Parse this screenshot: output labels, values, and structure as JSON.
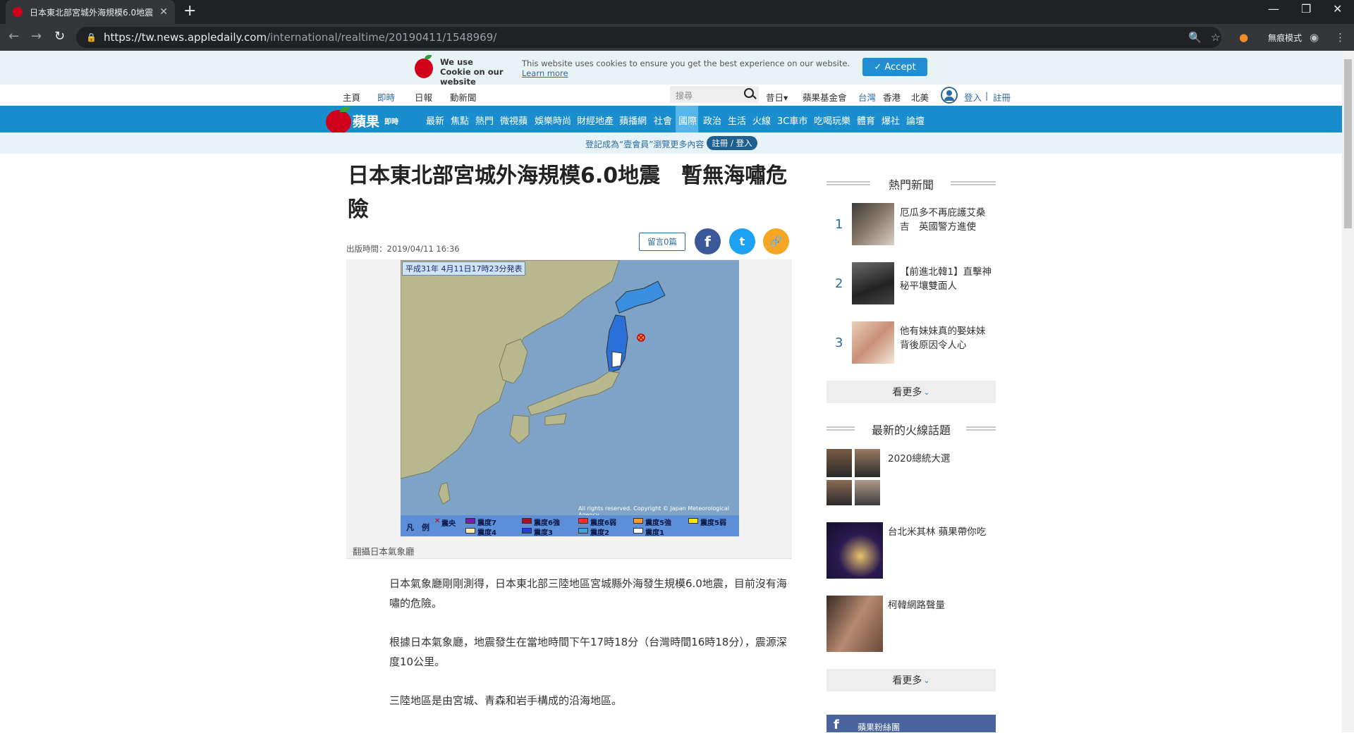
{
  "browser": {
    "tab_title": "日本東北部宮城外海規模6.0地震",
    "new_tab": "+",
    "url_host": "https://tw.news.appledaily.com",
    "url_path": "/international/realtime/20190411/1548969/",
    "incognito_label": "無痕模式",
    "window_controls": [
      "—",
      "❐",
      "✕"
    ]
  },
  "cookie_bar": {
    "title": "We use Cookie on our website",
    "message": "This website uses cookies to ensure you get the best experience on our website.",
    "learn_more": "Learn more",
    "accept": "✓ Accept"
  },
  "top_links": {
    "left": [
      "主頁",
      "即時",
      "日報",
      "動新聞"
    ],
    "search_placeholder": "搜尋",
    "past": "昔日▾",
    "fund": "蘋果基金會",
    "regions": [
      "台灣",
      "香港",
      "北美"
    ],
    "login": "登入",
    "separator": "|",
    "register": "註冊"
  },
  "main_nav": {
    "logo": "蘋果",
    "logo_sub": "即時",
    "items": [
      "最新",
      "焦點",
      "熱門",
      "微視蘋",
      "娛樂時尚",
      "財經地產",
      "蘋播網",
      "社會",
      "國際",
      "政治",
      "生活",
      "火線",
      "3C車市",
      "吃喝玩樂",
      "體育",
      "爆社",
      "論壇"
    ],
    "active": "國際"
  },
  "member": {
    "text": "登記成為“壹會員”瀏覽更多內容",
    "button": "註冊 / 登入"
  },
  "article": {
    "headline": "日本東北部宮城外海規模6.0地震　暫無海嘯危險",
    "published": "出版時間：2019/04/11 16:36",
    "comments": "留言0篇",
    "share": [
      "f",
      "t",
      "🔗"
    ],
    "map_header": "平成31年 4月11日17時23分発表",
    "map_copyright": "All rights reserved. Copyright © Japan Meteorological Agency",
    "legend_label": "凡　例",
    "legend_epicenter": "震央",
    "legend": [
      {
        "label": "震度7",
        "color": "#7b1fa2"
      },
      {
        "label": "震度6強",
        "color": "#a3122b"
      },
      {
        "label": "震度6弱",
        "color": "#ff2e2e"
      },
      {
        "label": "震度5強",
        "color": "#ff9a2e"
      },
      {
        "label": "震度5弱",
        "color": "#ffe600"
      },
      {
        "label": "震度4",
        "color": "#ffe9a8"
      },
      {
        "label": "震度3",
        "color": "#1f3fd6"
      },
      {
        "label": "震度2",
        "color": "#3aa3e8"
      },
      {
        "label": "震度1",
        "color": "#ffffff"
      }
    ],
    "caption": "翻攝日本氣象廳",
    "paragraphs": [
      "日本氣象廳剛剛測得，日本東北部三陸地區宮城縣外海發生規模6.0地震，目前沒有海嘯的危險。",
      "根據日本氣象廳，地震發生在當地時間下午17時18分（台灣時間16時18分），震源深度10公里。",
      "三陸地區是由宮城、青森和岩手構成的沿海地區。"
    ]
  },
  "sidebar": {
    "hot_heading": "熱門新聞",
    "hot": [
      {
        "rank": "1",
        "title": "厄瓜多不再庇護艾桑吉　英國警方進使"
      },
      {
        "rank": "2",
        "title": "【前進北韓1】直擊神秘平壤雙面人"
      },
      {
        "rank": "3",
        "title": "他有妹妹真的娶妹妹　背後原因令人心"
      }
    ],
    "more": "看更多",
    "fire_heading": "最新的火線話題",
    "fire": [
      {
        "title": "2020總統大選"
      },
      {
        "title": "台北米其林 蘋果帶你吃"
      },
      {
        "title": "柯韓網路聲量"
      }
    ],
    "fire_more": "看更多",
    "fb": "蘋果粉絲團"
  }
}
